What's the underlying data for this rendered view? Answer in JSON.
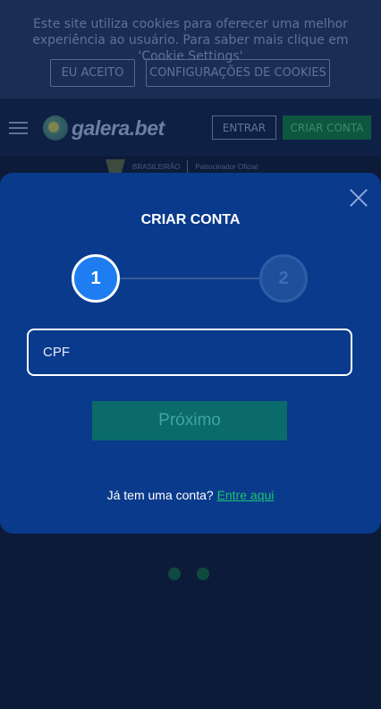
{
  "cookie_banner": {
    "text": "Este site utiliza cookies para oferecer uma melhor experiência ao usuário. Para saber mais clique em 'Cookie Settings'",
    "accept_label": "EU ACEITO",
    "settings_label": "CONFIGURAÇÕES DE COOKIES"
  },
  "header": {
    "logo_text": "galera.bet",
    "login_label": "ENTRAR",
    "signup_label": "CRIAR CONTA"
  },
  "sponsor": {
    "left_text": "BRASILEIRÃO",
    "right_text": "Patrocinador Oficial"
  },
  "modal": {
    "title": "CRIAR CONTA",
    "step1": "1",
    "step2": "2",
    "cpf_placeholder": "CPF",
    "next_label": "Próximo",
    "have_account": "Já tem uma conta?",
    "login_link": "Entre aqui"
  },
  "colors": {
    "modal_bg": "#0a3a8c",
    "step_active": "#1e7df0",
    "link": "#19c46d",
    "button_disabled": "#0b6a6a"
  }
}
